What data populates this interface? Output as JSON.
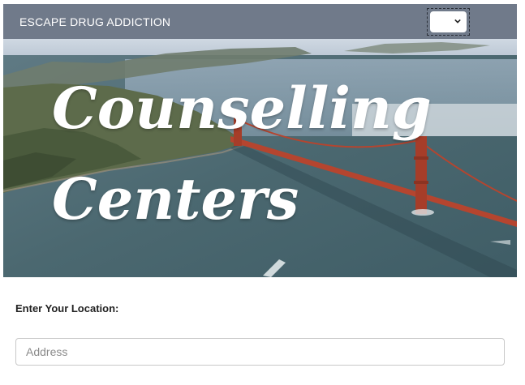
{
  "navbar": {
    "brand": "ESCAPE DRUG ADDICTION",
    "select_value": "",
    "select_icon": "chevron-down-icon"
  },
  "hero": {
    "title_line1": "Counselling",
    "title_line2": "Centers"
  },
  "form": {
    "location_label": "Enter Your Location:",
    "address_placeholder": "Address",
    "address_value": ""
  },
  "colors": {
    "navbar_bg": "#707a8a",
    "hero_text": "#ffffff",
    "bridge": "#b5452f"
  }
}
